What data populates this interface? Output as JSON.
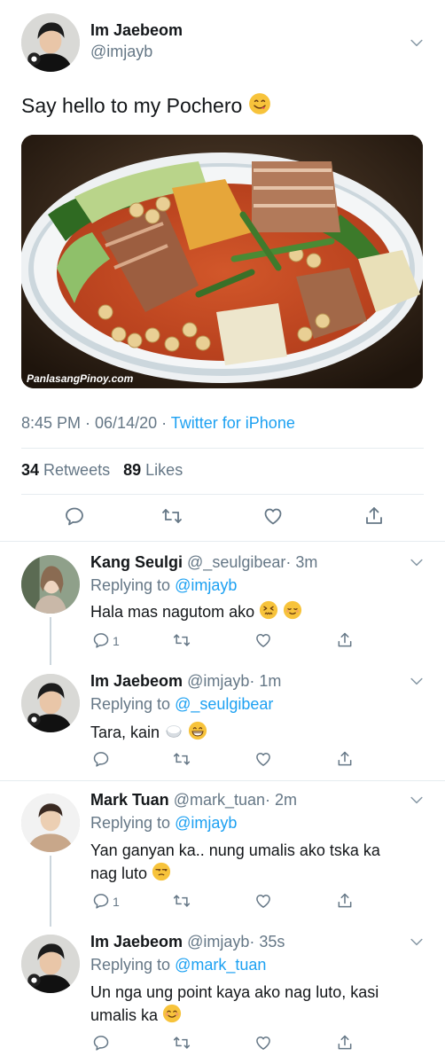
{
  "main_tweet": {
    "author_name": "Im Jaebeom",
    "author_handle": "@imjayb",
    "text": "Say hello to my Pochero",
    "image_watermark": "PanlasangPinoy.com",
    "timestamp": "8:45 PM · 06/14/20 · ",
    "source": "Twitter for iPhone",
    "retweets_count": "34",
    "retweets_label": "Retweets",
    "likes_count": "89",
    "likes_label": "Likes"
  },
  "replies": [
    {
      "name": "Kang Seulgi",
      "handle": "@_seulgibear",
      "time": "· 3m",
      "replying_label": "Replying to ",
      "replying_to": "@imjayb",
      "text": "Hala mas nagutom ako",
      "reply_count": "1"
    },
    {
      "name": "Im Jaebeom",
      "handle": "@imjayb",
      "time": "· 1m",
      "replying_label": "Replying to ",
      "replying_to": "@_seulgibear",
      "text": "Tara, kain",
      "reply_count": ""
    },
    {
      "name": "Mark Tuan",
      "handle": "@mark_tuan",
      "time": "· 2m",
      "replying_label": "Replying to ",
      "replying_to": "@imjayb",
      "text_line1": "Yan ganyan ka.. nung umalis ako tska ka",
      "text_line2": "nag luto",
      "reply_count": "1"
    },
    {
      "name": "Im Jaebeom",
      "handle": "@imjayb",
      "time": "· 35s",
      "replying_label": "Replying to ",
      "replying_to": "@mark_tuan",
      "text_line1": "Un nga ung point kaya ako nag luto, kasi",
      "text_line2": "umalis ka",
      "reply_count": ""
    }
  ],
  "icons": {
    "reply": "reply-icon",
    "retweet": "retweet-icon",
    "like": "heart-icon",
    "share": "share-icon",
    "more": "chevron-down-icon"
  },
  "colors": {
    "accent": "#1da1f2",
    "secondary_text": "#657786",
    "divider": "#e6ecf0"
  }
}
